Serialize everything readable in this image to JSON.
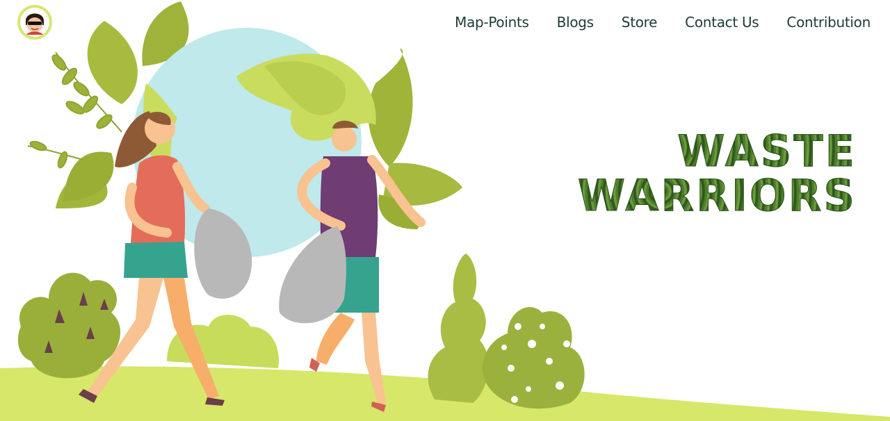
{
  "nav": {
    "items": [
      {
        "label": "Map-Points"
      },
      {
        "label": "Blogs"
      },
      {
        "label": "Store"
      },
      {
        "label": "Contact Us"
      },
      {
        "label": "Contribution"
      }
    ]
  },
  "hero": {
    "line1": "WASTE",
    "line2": "WARRIORS"
  },
  "colors": {
    "nav_text": "#1d3b36",
    "ground": "#d6e76a",
    "leaf": "#a4b83b",
    "globe_water": "#bfe9ea",
    "globe_land": "#c9dc5e",
    "hero_text": "#3e6d27"
  },
  "icons": [
    "avatar-icon"
  ]
}
